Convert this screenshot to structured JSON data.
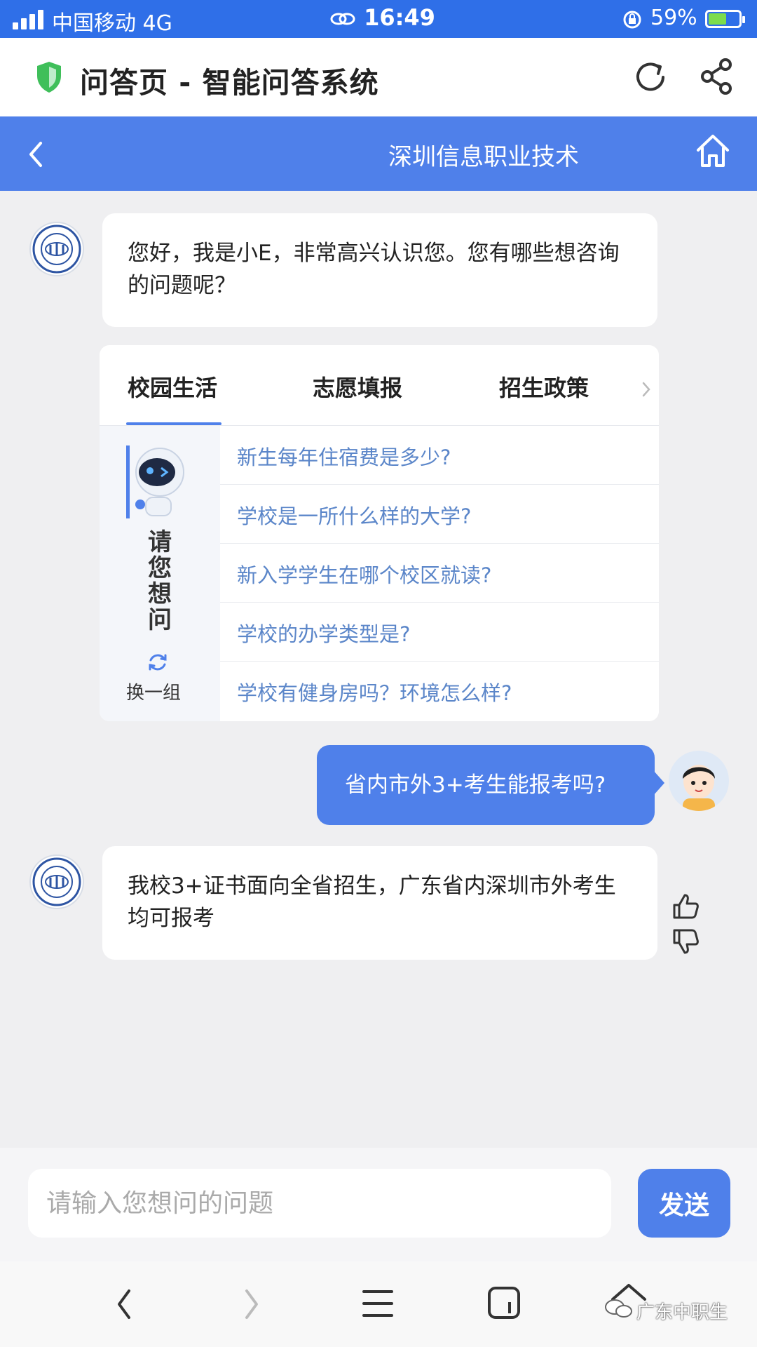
{
  "status_bar": {
    "carrier": "中国移动 4G",
    "time": "16:49",
    "battery_percent": "59%",
    "battery_level": 0.59
  },
  "browser": {
    "title": "问答页 - 智能问答系统"
  },
  "app_nav": {
    "title": "深圳信息职业技术"
  },
  "chat": {
    "greeting": "您好，我是小E，非常高兴认识您。您有哪些想咨询的问题呢？",
    "faq": {
      "tabs": [
        "校园生活",
        "志愿填报",
        "招生政策"
      ],
      "active_tab": 0,
      "ask_label": "请您想问",
      "refresh_label": "换一组",
      "questions": [
        "新生每年住宿费是多少?",
        "学校是一所什么样的大学?",
        "新入学学生在哪个校区就读?",
        "学校的办学类型是?",
        "学校有健身房吗？环境怎么样?"
      ]
    },
    "user_message": "省内市外3+考生能报考吗?",
    "bot_reply": "我校3+证书面向全省招生，广东省内深圳市外考生均可报考"
  },
  "input": {
    "placeholder": "请输入您想问的问题",
    "send_label": "发送"
  },
  "watermark": "广东中职生",
  "colors": {
    "status_bar": "#2f6fe8",
    "accent": "#4f80ea",
    "question_link": "#5b86c9",
    "shield": "#3fbf5a"
  }
}
